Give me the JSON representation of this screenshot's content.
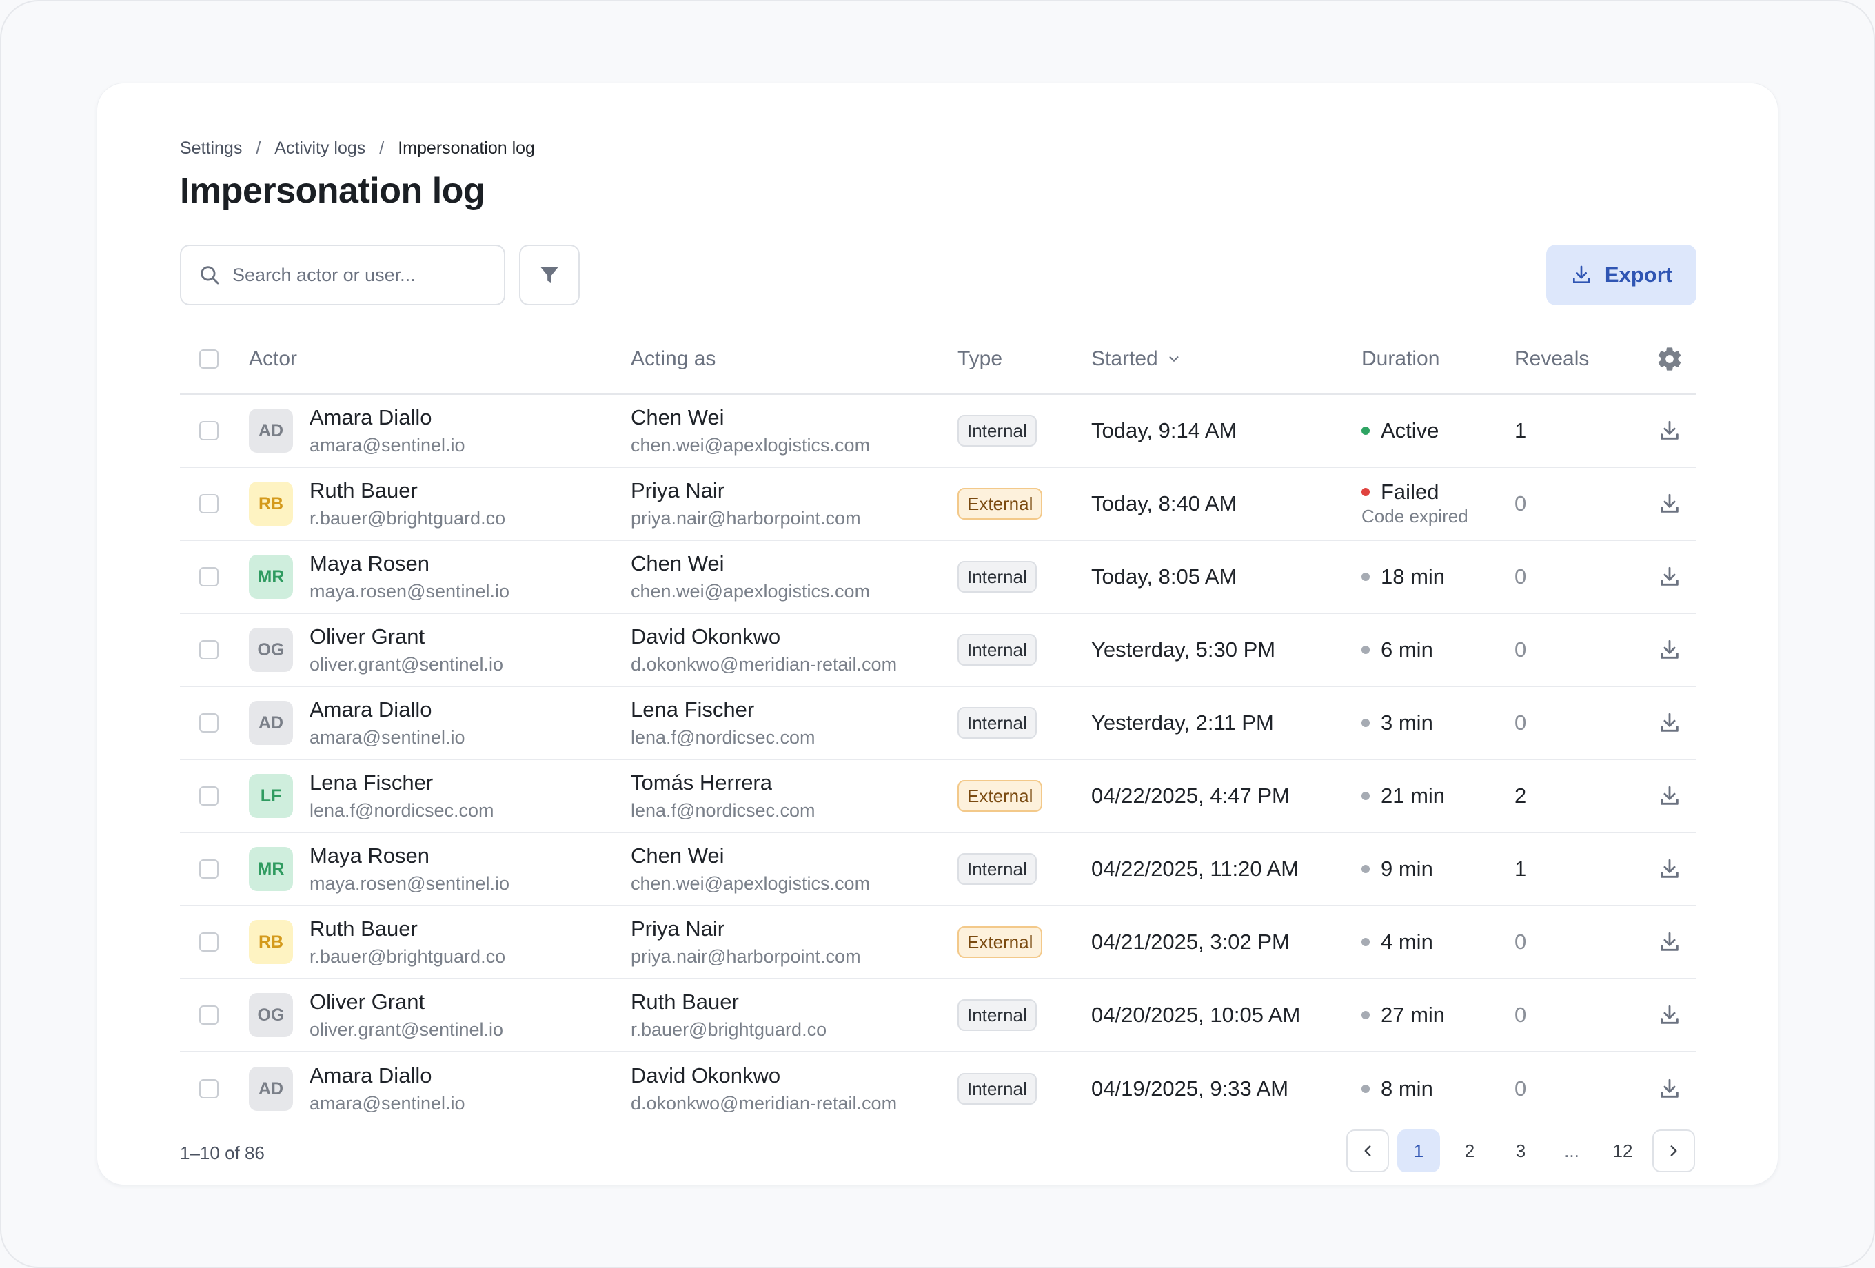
{
  "breadcrumb": [
    "Settings",
    "Activity logs",
    "Impersonation log"
  ],
  "title": "Impersonation log",
  "search": {
    "placeholder": "Search actor or user..."
  },
  "export_label": "Export",
  "columns": {
    "actor": "Actor",
    "acting_as": "Acting as",
    "type": "Type",
    "started": "Started",
    "duration": "Duration",
    "reveals": "Reveals"
  },
  "rows": [
    {
      "initials": "AD",
      "avatar_color": "gray",
      "actor_name": "Amara Diallo",
      "actor_email": "amara@sentinel.io",
      "as_name": "Chen Wei",
      "as_email": "chen.wei@apexlogistics.com",
      "type": "Internal",
      "started": "Today, 9:14 AM",
      "duration": "Active",
      "status": "active",
      "duration_note": "",
      "reveals": "1"
    },
    {
      "initials": "RB",
      "avatar_color": "yellow",
      "actor_name": "Ruth Bauer",
      "actor_email": "r.bauer@brightguard.co",
      "as_name": "Priya Nair",
      "as_email": "priya.nair@harborpoint.com",
      "type": "External",
      "started": "Today, 8:40 AM",
      "duration": "Failed",
      "status": "failed",
      "duration_note": "Code expired",
      "reveals": "0"
    },
    {
      "initials": "MR",
      "avatar_color": "green",
      "actor_name": "Maya Rosen",
      "actor_email": "maya.rosen@sentinel.io",
      "as_name": "Chen Wei",
      "as_email": "chen.wei@apexlogistics.com",
      "type": "Internal",
      "started": "Today, 8:05 AM",
      "duration": "18 min",
      "status": "ended",
      "duration_note": "",
      "reveals": "0"
    },
    {
      "initials": "OG",
      "avatar_color": "gray",
      "actor_name": "Oliver Grant",
      "actor_email": "oliver.grant@sentinel.io",
      "as_name": "David Okonkwo",
      "as_email": "d.okonkwo@meridian-retail.com",
      "type": "Internal",
      "started": "Yesterday, 5:30 PM",
      "duration": "6 min",
      "status": "ended",
      "duration_note": "",
      "reveals": "0"
    },
    {
      "initials": "AD",
      "avatar_color": "gray",
      "actor_name": "Amara Diallo",
      "actor_email": "amara@sentinel.io",
      "as_name": "Lena Fischer",
      "as_email": "lena.f@nordicsec.com",
      "type": "Internal",
      "started": "Yesterday, 2:11 PM",
      "duration": "3 min",
      "status": "ended",
      "duration_note": "",
      "reveals": "0"
    },
    {
      "initials": "LF",
      "avatar_color": "green",
      "actor_name": "Lena Fischer",
      "actor_email": "lena.f@nordicsec.com",
      "as_name": "Tomás Herrera",
      "as_email": "lena.f@nordicsec.com",
      "type": "External",
      "started": "04/22/2025, 4:47 PM",
      "duration": "21 min",
      "status": "ended",
      "duration_note": "",
      "reveals": "2"
    },
    {
      "initials": "MR",
      "avatar_color": "green",
      "actor_name": "Maya Rosen",
      "actor_email": "maya.rosen@sentinel.io",
      "as_name": "Chen Wei",
      "as_email": "chen.wei@apexlogistics.com",
      "type": "Internal",
      "started": "04/22/2025, 11:20 AM",
      "duration": "9 min",
      "status": "ended",
      "duration_note": "",
      "reveals": "1"
    },
    {
      "initials": "RB",
      "avatar_color": "yellow",
      "actor_name": "Ruth Bauer",
      "actor_email": "r.bauer@brightguard.co",
      "as_name": "Priya Nair",
      "as_email": "priya.nair@harborpoint.com",
      "type": "External",
      "started": "04/21/2025, 3:02 PM",
      "duration": "4 min",
      "status": "ended",
      "duration_note": "",
      "reveals": "0"
    },
    {
      "initials": "OG",
      "avatar_color": "gray",
      "actor_name": "Oliver Grant",
      "actor_email": "oliver.grant@sentinel.io",
      "as_name": "Ruth Bauer",
      "as_email": "r.bauer@brightguard.co",
      "type": "Internal",
      "started": "04/20/2025, 10:05 AM",
      "duration": "27 min",
      "status": "ended",
      "duration_note": "",
      "reveals": "0"
    },
    {
      "initials": "AD",
      "avatar_color": "gray",
      "actor_name": "Amara Diallo",
      "actor_email": "amara@sentinel.io",
      "as_name": "David Okonkwo",
      "as_email": "d.okonkwo@meridian-retail.com",
      "type": "Internal",
      "started": "04/19/2025, 9:33 AM",
      "duration": "8 min",
      "status": "ended",
      "duration_note": "",
      "reveals": "0"
    }
  ],
  "footer": {
    "range": "1–10 of 86"
  },
  "pagination": {
    "pages": [
      "1",
      "2",
      "3",
      "...",
      "12"
    ],
    "current": "1"
  },
  "colors": {
    "accent": "#2f55b3",
    "accent_bg": "#dde7fb",
    "active": "#2fa463",
    "failed": "#e0433f"
  },
  "icons": {
    "search": "search-icon",
    "filter": "filter-icon",
    "export": "download-icon",
    "settings": "gear-icon",
    "sort": "chevron-down-icon",
    "row_action": "download-icon"
  }
}
